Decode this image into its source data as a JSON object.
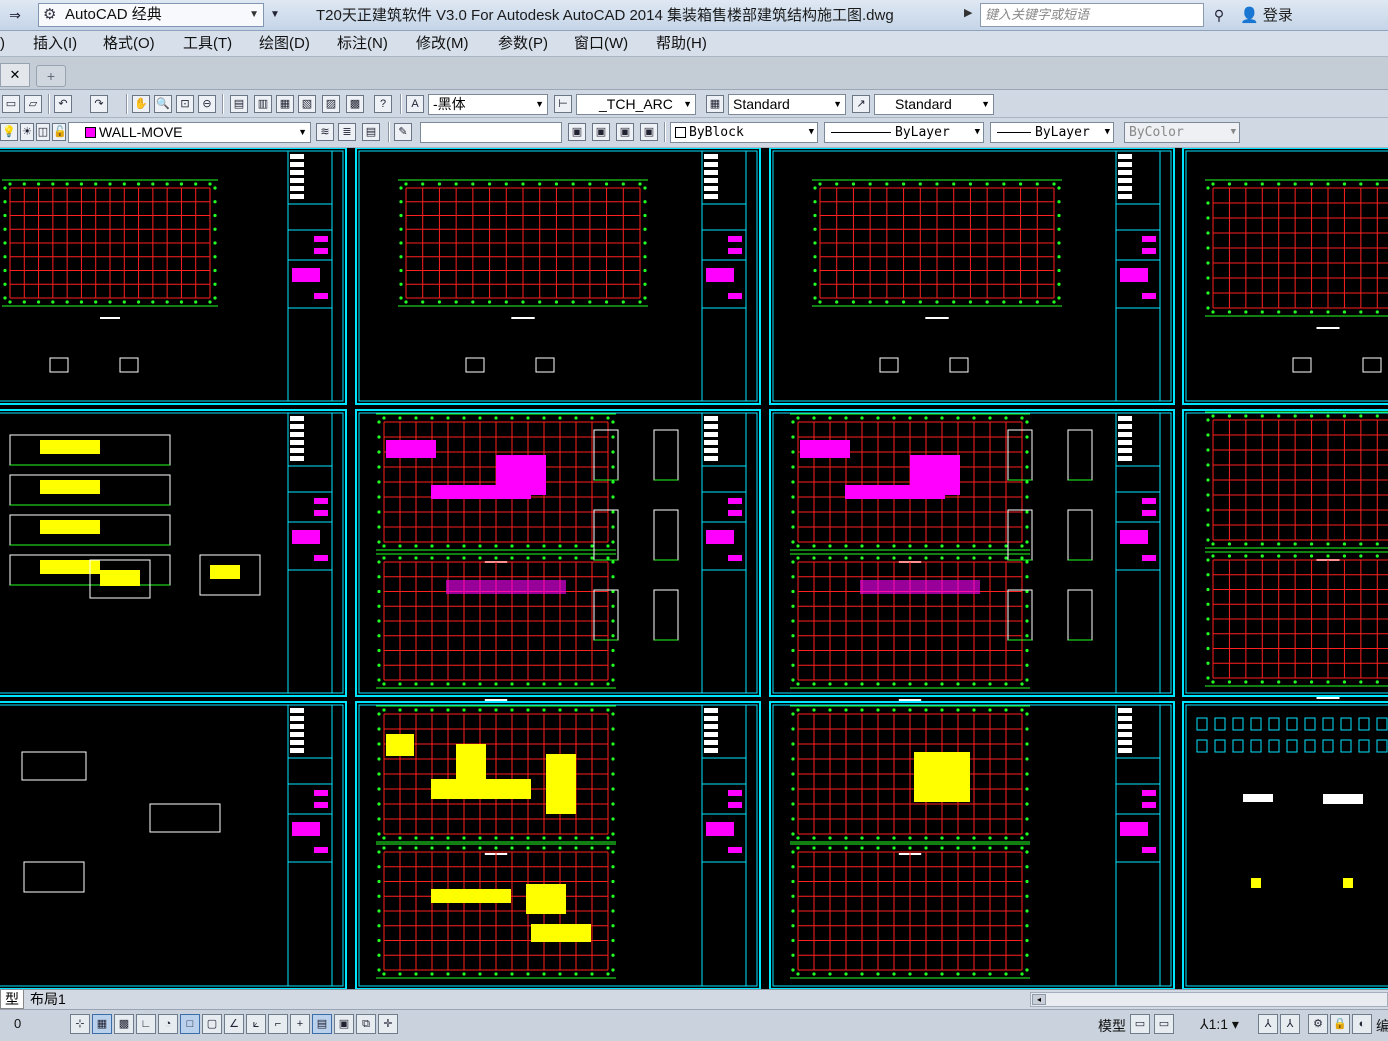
{
  "titlebar": {
    "workspace": "AutoCAD 经典",
    "title": "T20天正建筑软件 V3.0 For Autodesk AutoCAD 2014    集装箱售楼部建筑结构施工图.dwg",
    "search_placeholder": "键入关键字或短语",
    "login": "登录"
  },
  "menu": {
    "items": [
      "插入(I)",
      "格式(O)",
      "工具(T)",
      "绘图(D)",
      "标注(N)",
      "修改(M)",
      "参数(P)",
      "窗口(W)",
      "帮助(H)"
    ]
  },
  "toolbar1": {
    "text_style": "-黑体",
    "dim_style": "_TCH_ARC",
    "table_style": "Standard",
    "multileader_style": "Standard"
  },
  "toolbar2": {
    "layer": "WALL-MOVE",
    "color": "ByBlock",
    "linetype": "ByLayer",
    "lineweight": "ByLayer",
    "plotstyle": "ByColor"
  },
  "layout_tabs": {
    "model": "型",
    "layout1": "布局1"
  },
  "statusbar": {
    "coord": "0",
    "model_label": "模型",
    "annotation_scale": "1:1"
  },
  "colors": {
    "frame": "#00e5ff",
    "grid_red": "#ff2020",
    "grid_green": "#22ff22",
    "magenta": "#ff00ff",
    "yellow": "#ffff00",
    "white": "#ffffff"
  },
  "sheets": {
    "count": 12,
    "columns": 4,
    "rows": 3
  }
}
